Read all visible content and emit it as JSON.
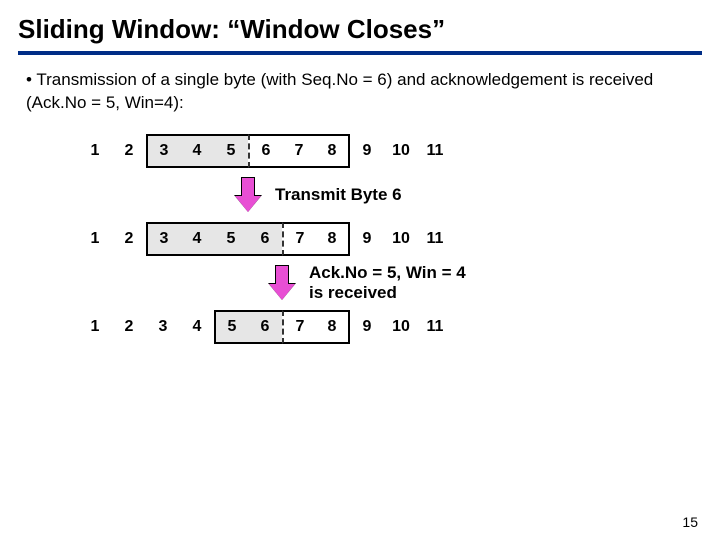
{
  "title_main": "Sliding Window:",
  "title_sub": "“Window Closes”",
  "bullet": "• Transmission of a single byte (with Seq.No = 6) and acknowledgement is received (Ack.No = 5, Win=4):",
  "numbers": [
    "1",
    "2",
    "3",
    "4",
    "5",
    "6",
    "7",
    "8",
    "9",
    "10",
    "11"
  ],
  "row1_window": {
    "start": 3,
    "end": 8,
    "fill_start": 3,
    "fill_end": 5,
    "dash_after": 5
  },
  "row2_window": {
    "start": 3,
    "end": 8,
    "fill_start": 3,
    "fill_end": 6,
    "dash_after": 6
  },
  "row3_window": {
    "start": 5,
    "end": 8,
    "fill_start": 5,
    "fill_end": 6,
    "dash_after": 6
  },
  "arrow_offsets": {
    "r1": 5,
    "r2": 6
  },
  "caption1": "Transmit Byte 6",
  "caption2_l1": "Ack.No = 5, Win = 4",
  "caption2_l2": "is received",
  "pagenum": "15",
  "chart_data": {
    "type": "table",
    "description": "Sliding window states over sequence numbers 1..11",
    "sequence_numbers": [
      1,
      2,
      3,
      4,
      5,
      6,
      7,
      8,
      9,
      10,
      11
    ],
    "states": [
      {
        "stage": "before",
        "window": [
          3,
          8
        ],
        "sent_unacked": [
          3,
          5
        ],
        "usable": [
          6,
          8
        ],
        "pointer_after": 5
      },
      {
        "stage": "after_transmit_byte_6",
        "window": [
          3,
          8
        ],
        "sent_unacked": [
          3,
          6
        ],
        "usable": [
          7,
          8
        ],
        "pointer_after": 6
      },
      {
        "stage": "after_ack5_win4",
        "window": [
          5,
          8
        ],
        "sent_unacked": [
          5,
          6
        ],
        "usable": [
          7,
          8
        ],
        "pointer_after": 6
      }
    ],
    "events": [
      {
        "after_stage": 0,
        "label": "Transmit Byte 6"
      },
      {
        "after_stage": 1,
        "label": "Ack.No = 5, Win = 4 is received"
      }
    ]
  }
}
